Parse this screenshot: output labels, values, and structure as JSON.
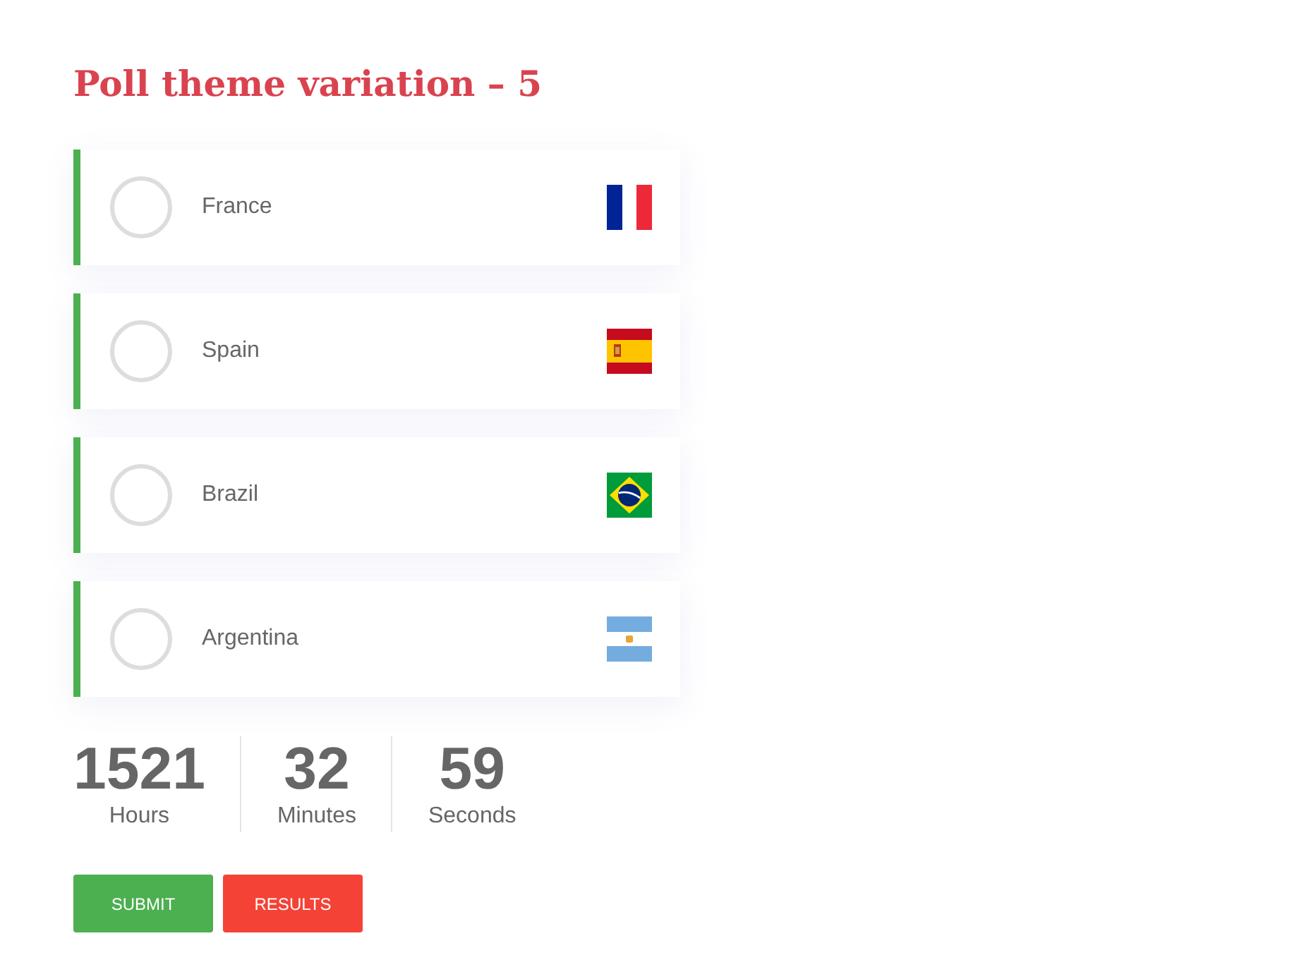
{
  "title": "Poll theme variation – 5",
  "options": [
    {
      "label": "France",
      "selected": false
    },
    {
      "label": "Spain",
      "selected": false
    },
    {
      "label": "Brazil",
      "selected": false
    },
    {
      "label": "Argentina",
      "selected": false
    }
  ],
  "countdown": [
    {
      "value": "1521",
      "unit": "Hours"
    },
    {
      "value": "32",
      "unit": "Minutes"
    },
    {
      "value": "59",
      "unit": "Seconds"
    }
  ],
  "buttons": [
    {
      "label": "SUBMIT",
      "kind": "submit"
    },
    {
      "label": "RESULTS",
      "kind": "results"
    }
  ]
}
